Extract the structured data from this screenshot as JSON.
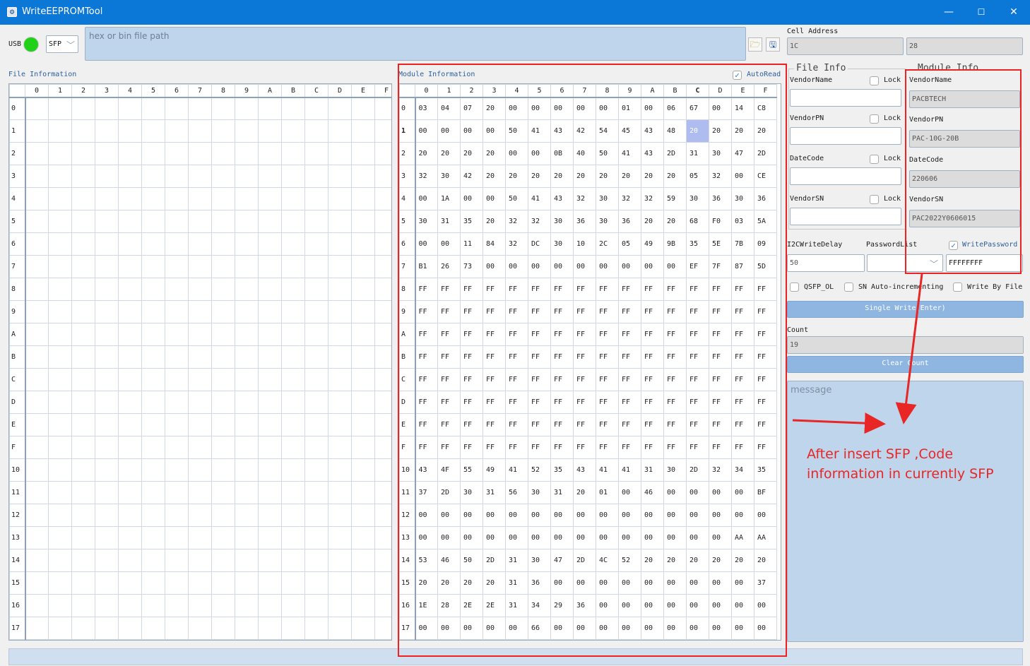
{
  "window": {
    "title": "WriteEEPROMTool",
    "minimize": "—",
    "maximize": "☐",
    "close": "✕"
  },
  "toolbar": {
    "usb_label": "USB",
    "status_color": "#21d119",
    "module_type": "SFP",
    "file_path_placeholder": "hex or bin file path"
  },
  "file_info_panel": {
    "title": "File Information",
    "columns": [
      "0",
      "1",
      "2",
      "3",
      "4",
      "5",
      "6",
      "7",
      "8",
      "9",
      "A",
      "B",
      "C",
      "D",
      "E",
      "F"
    ],
    "row_labels": [
      "0",
      "1",
      "2",
      "3",
      "4",
      "5",
      "6",
      "7",
      "8",
      "9",
      "A",
      "B",
      "C",
      "D",
      "E",
      "F",
      "10",
      "11",
      "12",
      "13",
      "14",
      "15",
      "16",
      "17"
    ]
  },
  "module_info_panel": {
    "title": "Module Information",
    "autoread_label": "AutoRead",
    "autoread_checked": true,
    "selected_cell": {
      "row": 1,
      "col": 12
    },
    "columns": [
      "0",
      "1",
      "2",
      "3",
      "4",
      "5",
      "6",
      "7",
      "8",
      "9",
      "A",
      "B",
      "C",
      "D",
      "E",
      "F"
    ],
    "row_labels": [
      "0",
      "1",
      "2",
      "3",
      "4",
      "5",
      "6",
      "7",
      "8",
      "9",
      "A",
      "B",
      "C",
      "D",
      "E",
      "F",
      "10",
      "11",
      "12",
      "13",
      "14",
      "15",
      "16",
      "17"
    ],
    "rows": [
      [
        "03",
        "04",
        "07",
        "20",
        "00",
        "00",
        "00",
        "00",
        "00",
        "01",
        "00",
        "06",
        "67",
        "00",
        "14",
        "C8"
      ],
      [
        "00",
        "00",
        "00",
        "00",
        "50",
        "41",
        "43",
        "42",
        "54",
        "45",
        "43",
        "48",
        "20",
        "20",
        "20",
        "20"
      ],
      [
        "20",
        "20",
        "20",
        "20",
        "00",
        "00",
        "0B",
        "40",
        "50",
        "41",
        "43",
        "2D",
        "31",
        "30",
        "47",
        "2D"
      ],
      [
        "32",
        "30",
        "42",
        "20",
        "20",
        "20",
        "20",
        "20",
        "20",
        "20",
        "20",
        "20",
        "05",
        "32",
        "00",
        "CE"
      ],
      [
        "00",
        "1A",
        "00",
        "00",
        "50",
        "41",
        "43",
        "32",
        "30",
        "32",
        "32",
        "59",
        "30",
        "36",
        "30",
        "36"
      ],
      [
        "30",
        "31",
        "35",
        "20",
        "32",
        "32",
        "30",
        "36",
        "30",
        "36",
        "20",
        "20",
        "68",
        "F0",
        "03",
        "5A"
      ],
      [
        "00",
        "00",
        "11",
        "84",
        "32",
        "DC",
        "30",
        "10",
        "2C",
        "05",
        "49",
        "9B",
        "35",
        "5E",
        "7B",
        "09"
      ],
      [
        "B1",
        "26",
        "73",
        "00",
        "00",
        "00",
        "00",
        "00",
        "00",
        "00",
        "00",
        "00",
        "EF",
        "7F",
        "87",
        "5D"
      ],
      [
        "FF",
        "FF",
        "FF",
        "FF",
        "FF",
        "FF",
        "FF",
        "FF",
        "FF",
        "FF",
        "FF",
        "FF",
        "FF",
        "FF",
        "FF",
        "FF"
      ],
      [
        "FF",
        "FF",
        "FF",
        "FF",
        "FF",
        "FF",
        "FF",
        "FF",
        "FF",
        "FF",
        "FF",
        "FF",
        "FF",
        "FF",
        "FF",
        "FF"
      ],
      [
        "FF",
        "FF",
        "FF",
        "FF",
        "FF",
        "FF",
        "FF",
        "FF",
        "FF",
        "FF",
        "FF",
        "FF",
        "FF",
        "FF",
        "FF",
        "FF"
      ],
      [
        "FF",
        "FF",
        "FF",
        "FF",
        "FF",
        "FF",
        "FF",
        "FF",
        "FF",
        "FF",
        "FF",
        "FF",
        "FF",
        "FF",
        "FF",
        "FF"
      ],
      [
        "FF",
        "FF",
        "FF",
        "FF",
        "FF",
        "FF",
        "FF",
        "FF",
        "FF",
        "FF",
        "FF",
        "FF",
        "FF",
        "FF",
        "FF",
        "FF"
      ],
      [
        "FF",
        "FF",
        "FF",
        "FF",
        "FF",
        "FF",
        "FF",
        "FF",
        "FF",
        "FF",
        "FF",
        "FF",
        "FF",
        "FF",
        "FF",
        "FF"
      ],
      [
        "FF",
        "FF",
        "FF",
        "FF",
        "FF",
        "FF",
        "FF",
        "FF",
        "FF",
        "FF",
        "FF",
        "FF",
        "FF",
        "FF",
        "FF",
        "FF"
      ],
      [
        "FF",
        "FF",
        "FF",
        "FF",
        "FF",
        "FF",
        "FF",
        "FF",
        "FF",
        "FF",
        "FF",
        "FF",
        "FF",
        "FF",
        "FF",
        "FF"
      ],
      [
        "43",
        "4F",
        "55",
        "49",
        "41",
        "52",
        "35",
        "43",
        "41",
        "41",
        "31",
        "30",
        "2D",
        "32",
        "34",
        "35"
      ],
      [
        "37",
        "2D",
        "30",
        "31",
        "56",
        "30",
        "31",
        "20",
        "01",
        "00",
        "46",
        "00",
        "00",
        "00",
        "00",
        "BF"
      ],
      [
        "00",
        "00",
        "00",
        "00",
        "00",
        "00",
        "00",
        "00",
        "00",
        "00",
        "00",
        "00",
        "00",
        "00",
        "00",
        "00"
      ],
      [
        "00",
        "00",
        "00",
        "00",
        "00",
        "00",
        "00",
        "00",
        "00",
        "00",
        "00",
        "00",
        "00",
        "00",
        "AA",
        "AA"
      ],
      [
        "53",
        "46",
        "50",
        "2D",
        "31",
        "30",
        "47",
        "2D",
        "4C",
        "52",
        "20",
        "20",
        "20",
        "20",
        "20",
        "20"
      ],
      [
        "20",
        "20",
        "20",
        "20",
        "31",
        "36",
        "00",
        "00",
        "00",
        "00",
        "00",
        "00",
        "00",
        "00",
        "00",
        "37"
      ],
      [
        "1E",
        "28",
        "2E",
        "2E",
        "31",
        "34",
        "29",
        "36",
        "00",
        "00",
        "00",
        "00",
        "00",
        "00",
        "00",
        "00"
      ],
      [
        "00",
        "00",
        "00",
        "00",
        "00",
        "66",
        "00",
        "00",
        "00",
        "00",
        "00",
        "00",
        "00",
        "00",
        "00",
        "00"
      ]
    ]
  },
  "cell_address": {
    "label": "Cell Address",
    "value1": "1C",
    "value2": "28"
  },
  "file_info_group": {
    "title": "File Info",
    "lock_label": "Lock",
    "fields": [
      {
        "label": "VendorName",
        "value": ""
      },
      {
        "label": "VendorPN",
        "value": ""
      },
      {
        "label": "DateCode",
        "value": ""
      },
      {
        "label": "VendorSN",
        "value": ""
      }
    ]
  },
  "module_info_group": {
    "title": "Module Info",
    "fields": [
      {
        "label": "VendorName",
        "value": "PACBTECH"
      },
      {
        "label": "VendorPN",
        "value": "PAC-10G-20B"
      },
      {
        "label": "DateCode",
        "value": "220606"
      },
      {
        "label": "VendorSN",
        "value": "PAC2022Y0606015"
      }
    ]
  },
  "settings": {
    "i2c_label": "I2CWriteDelay",
    "i2c_value": "50",
    "password_list_label": "PasswordList",
    "write_password_label": "WritePassword",
    "write_password_checked": true,
    "password_value": "FFFFFFFF",
    "qsfp_ol_label": "QSFP_OL",
    "sn_auto_label": "SN Auto-incrementing",
    "write_by_file_label": "Write By File"
  },
  "actions": {
    "single_write_label": "Single Write(Enter)",
    "count_label": "Count",
    "count_value": "19",
    "clear_count_label": "Clear Count",
    "message_placeholder": "message"
  },
  "annotation": {
    "line1": "After insert SFP ,Code",
    "line2": "information in currently SFP",
    "color": "#e82626"
  }
}
